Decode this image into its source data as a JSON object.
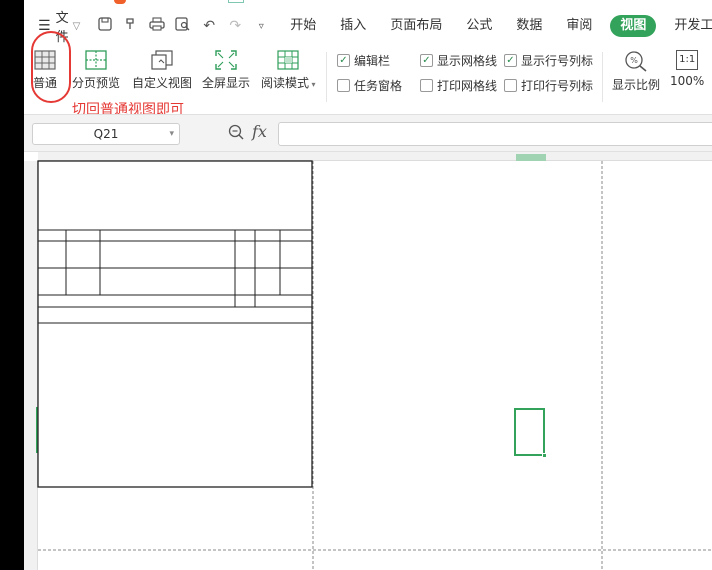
{
  "menu": {
    "file_label": "文件",
    "tabs": [
      "开始",
      "插入",
      "页面布局",
      "公式",
      "数据",
      "审阅",
      "视图",
      "开发工"
    ],
    "active_tab": "视图"
  },
  "ribbon": {
    "normal": "普通",
    "page_break_preview": "分页预览",
    "custom_view": "自定义视图",
    "full_screen": "全屏显示",
    "reading_mode": "阅读模式",
    "edit_bar": "编辑栏",
    "task_pane": "任务窗格",
    "show_gridlines": "显示网格线",
    "print_gridlines": "打印网格线",
    "show_headings": "显示行号列标",
    "print_headings": "打印行号列标",
    "zoom_label": "显示比例",
    "zoom_value": "100%",
    "zoom_box": "1:1",
    "zoom_percent_icon": "%"
  },
  "annotation": "切回普通视图即可",
  "formula_bar": {
    "cell_ref": "Q21",
    "fx": "fx",
    "formula": ""
  },
  "colors": {
    "accent_green": "#33a35b",
    "annotation_red": "#e53935"
  },
  "icons": [
    "menu-icon",
    "save-icon",
    "format-painter-icon",
    "print-icon",
    "print-preview-icon",
    "undo-icon",
    "redo-icon",
    "zoom-icon"
  ]
}
